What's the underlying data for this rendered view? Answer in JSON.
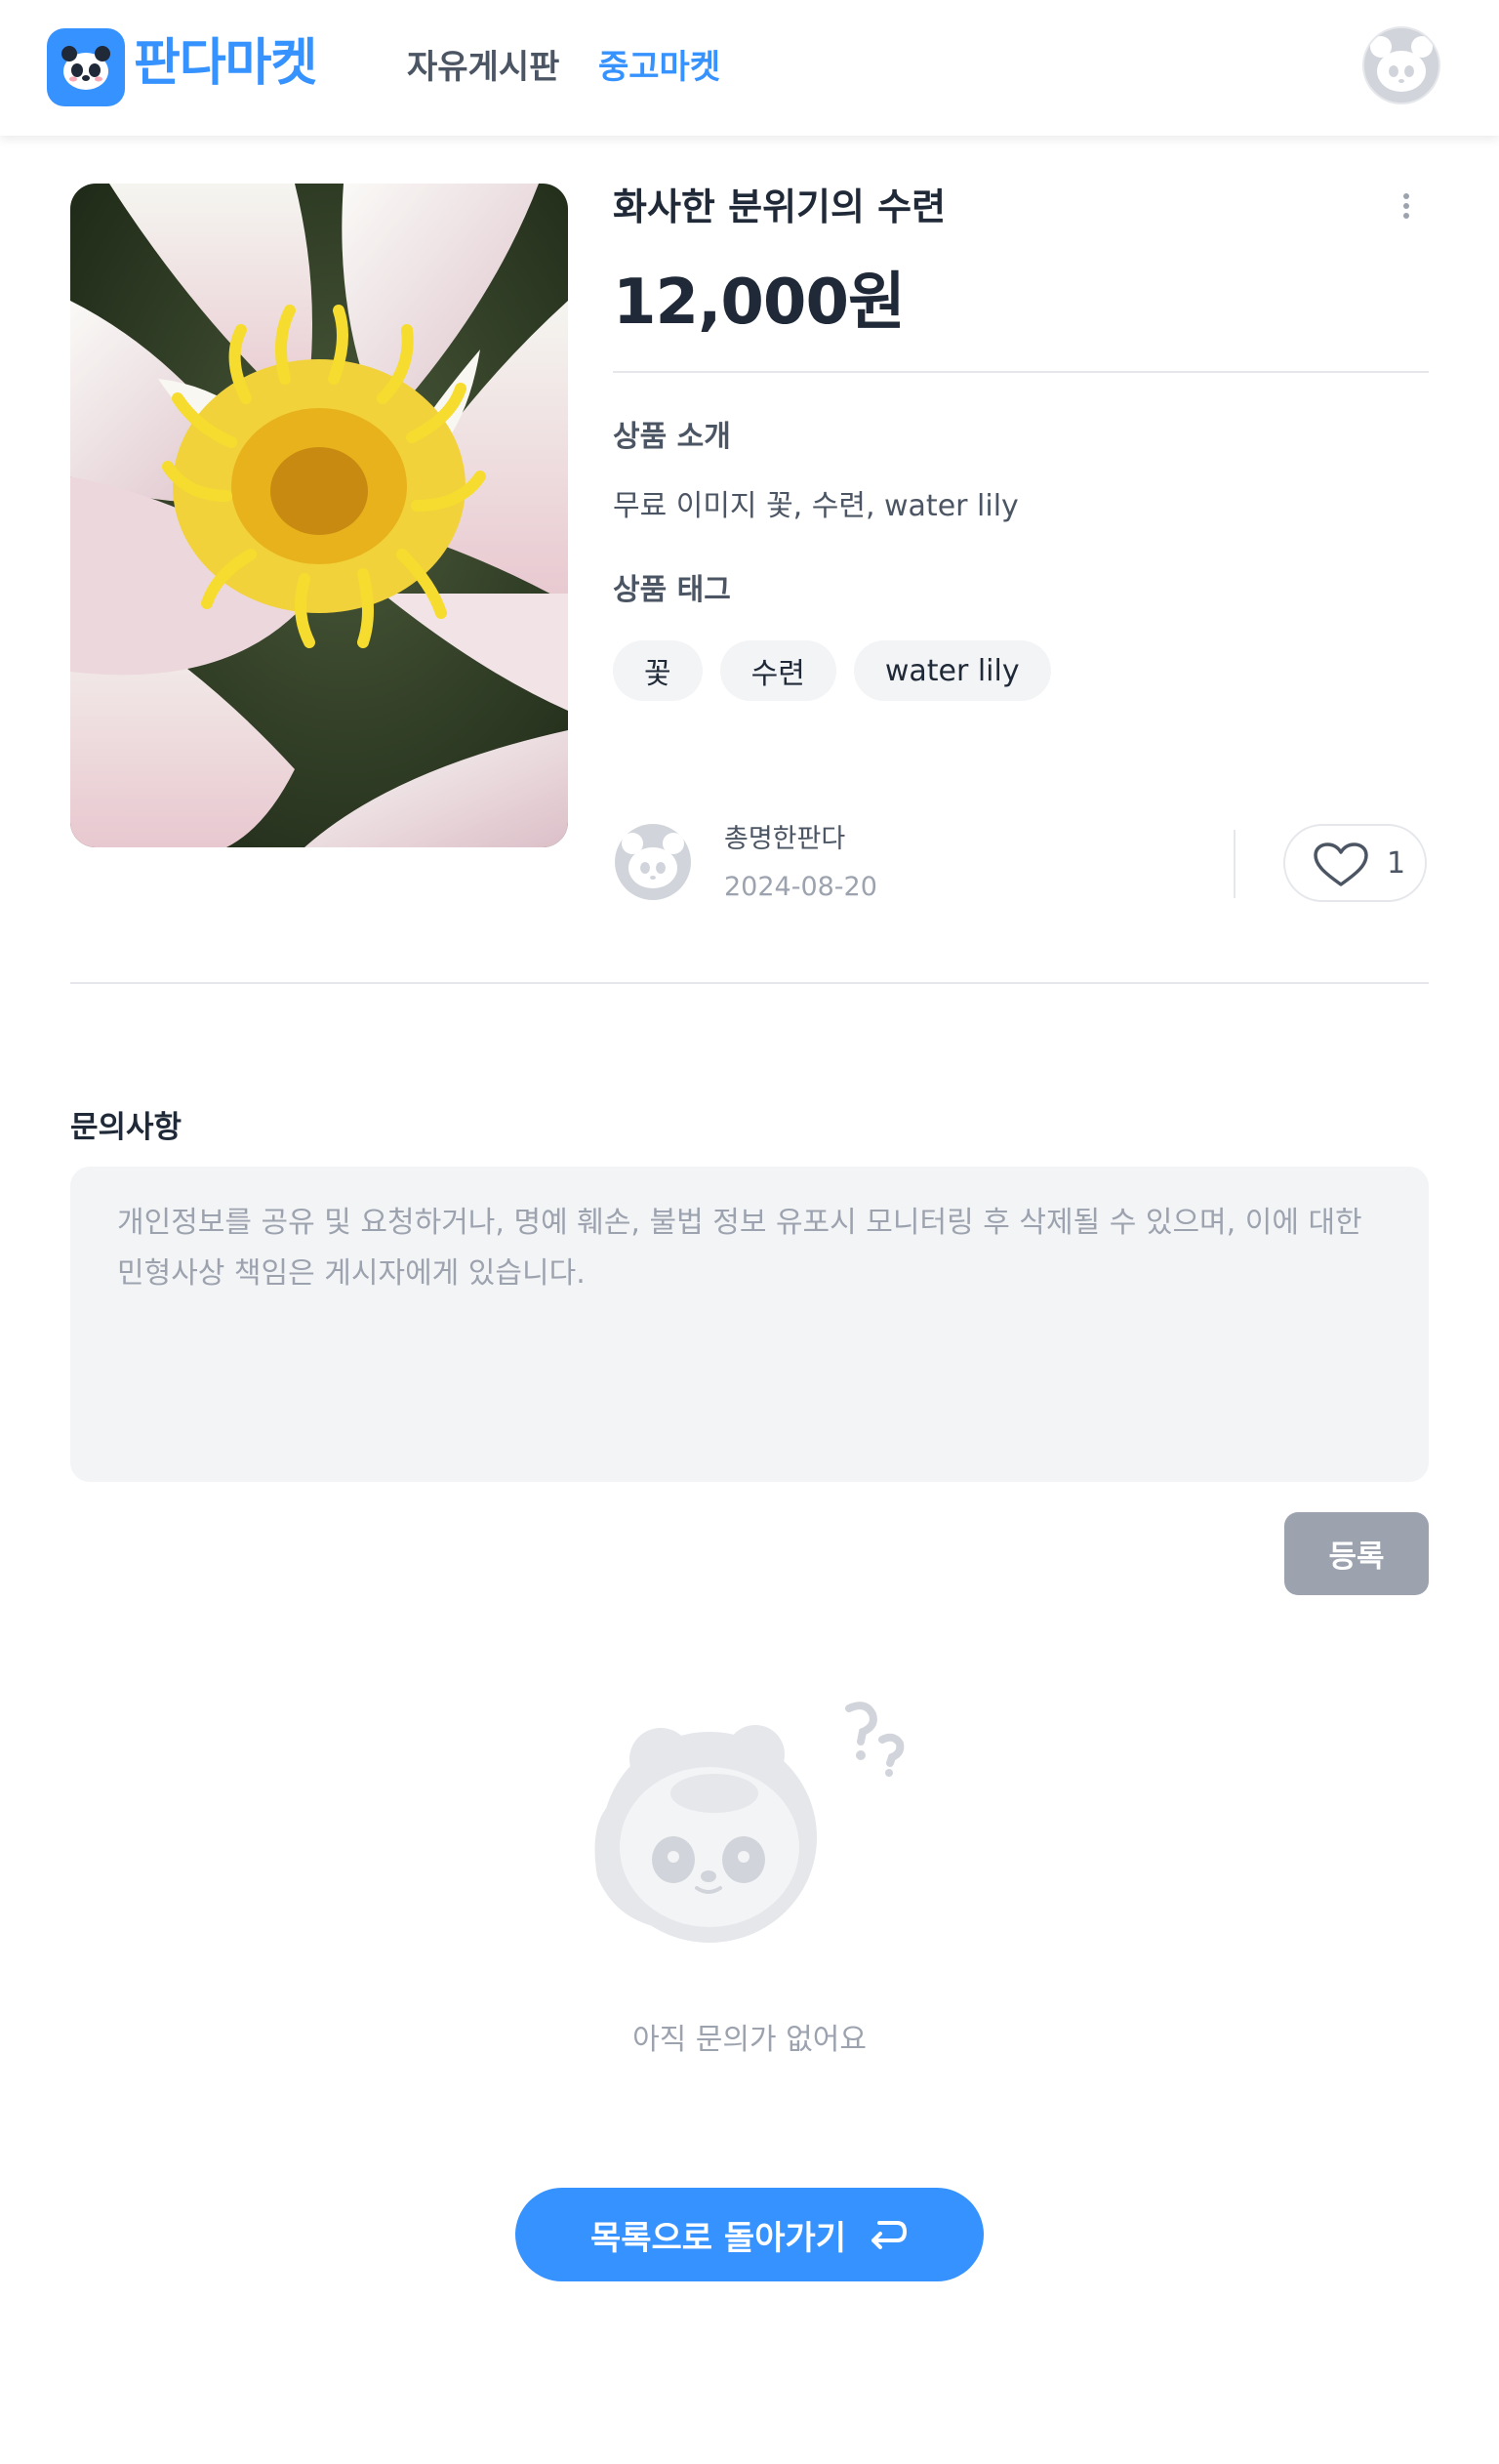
{
  "header": {
    "logo_text": "판다마켓",
    "nav": [
      {
        "label": "자유게시판",
        "active": false
      },
      {
        "label": "중고마켓",
        "active": true
      }
    ]
  },
  "product": {
    "title": "화사한 분위기의 수련",
    "price": "12,000원",
    "intro_label": "상품 소개",
    "intro_text": "무료 이미지 꽃, 수련, water lily",
    "tags_label": "상품 태그",
    "tags": [
      "꽃",
      "수련",
      "water lily"
    ],
    "seller": {
      "name": "총명한판다",
      "date": "2024-08-20"
    },
    "like_count": "1"
  },
  "inquiry": {
    "title": "문의사항",
    "placeholder": "개인정보를 공유 및 요청하거나, 명예 훼손, 불법 정보 유포시 모니터링 후 삭제될 수 있으며, 이에 대한 민형사상 책임은 게시자에게 있습니다.",
    "submit_label": "등록",
    "empty_text": "아직 문의가 없어요"
  },
  "back_button_label": "목록으로 돌아가기",
  "colors": {
    "brand": "#3692ff",
    "muted": "#9ca3af",
    "text": "#1f2937",
    "surface": "#f3f4f6"
  },
  "icons": [
    "panda-logo-icon",
    "user-avatar-icon",
    "kebab-menu-icon",
    "heart-icon",
    "panda-empty-illustration",
    "return-arrow-icon"
  ]
}
